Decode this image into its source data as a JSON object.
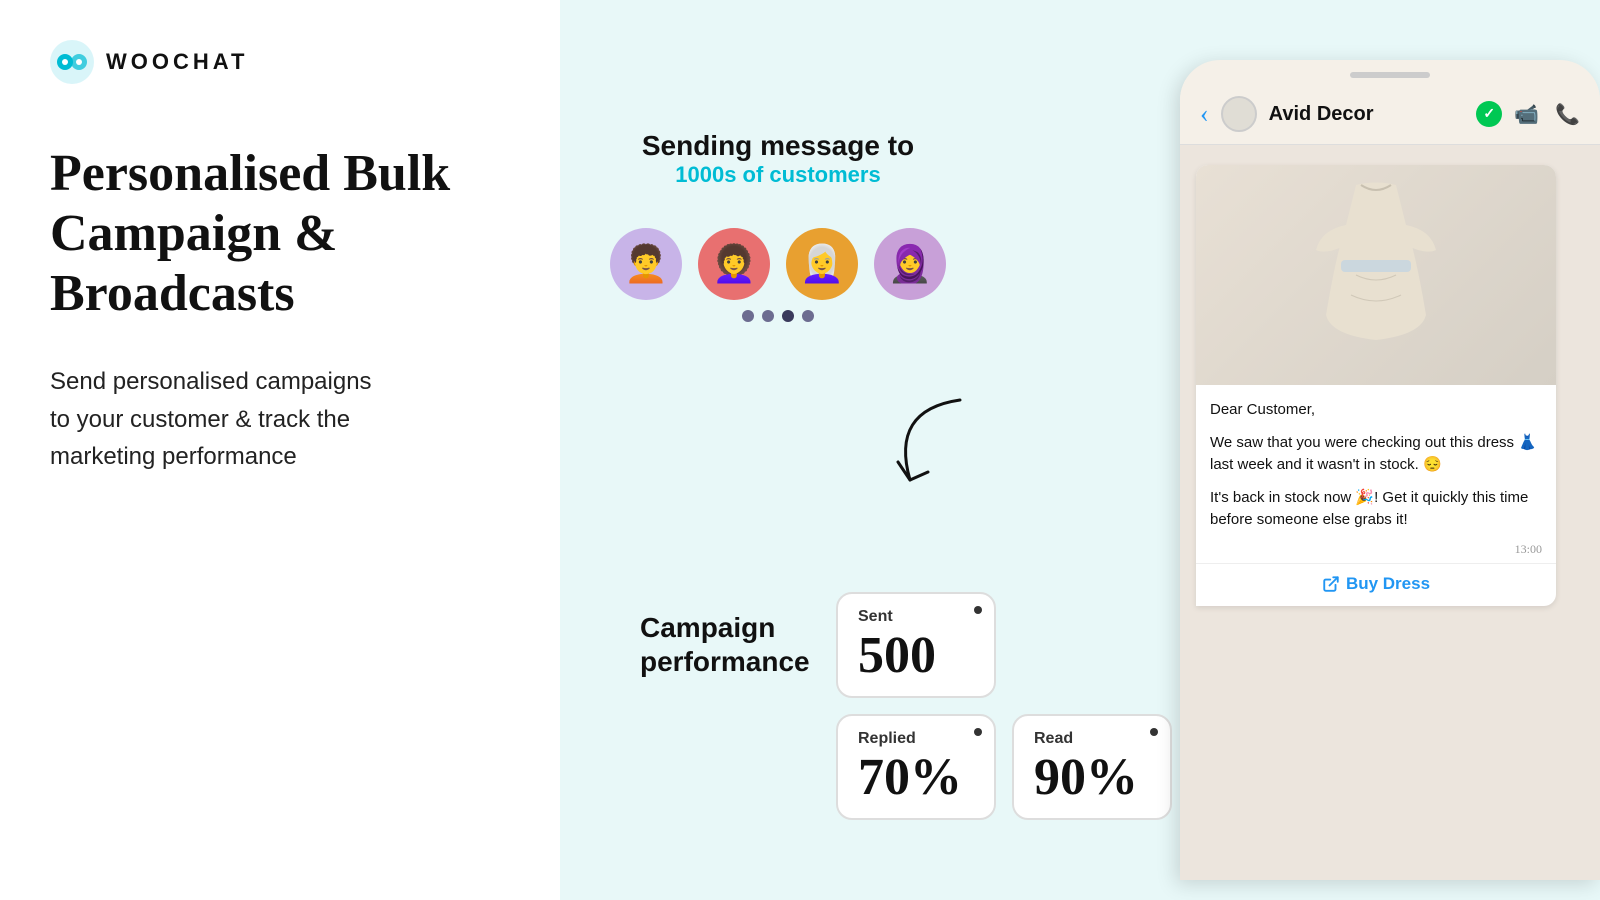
{
  "logo": {
    "text": "WOOCHAT"
  },
  "hero": {
    "heading_line1": "Personalised Bulk",
    "heading_line2": "Campaign & Broadcasts",
    "description_line1": "Send personalised campaigns",
    "description_line2": "to your customer & track the",
    "description_line3": "marketing performance"
  },
  "sending": {
    "title": "Sending message to",
    "subtitle": "1000s of customers"
  },
  "avatars": [
    {
      "emoji": "🧑‍🦱",
      "bg": "#c8b4e8"
    },
    {
      "emoji": "👩‍🦱",
      "bg": "#e87070"
    },
    {
      "emoji": "👩‍🦳",
      "bg": "#e8a030"
    },
    {
      "emoji": "🧕",
      "bg": "#c8a0d8"
    }
  ],
  "campaign": {
    "label_line1": "Campaign",
    "label_line2": "performance"
  },
  "stats": {
    "sent": {
      "label": "Sent",
      "value": "500"
    },
    "replied": {
      "label": "Replied",
      "value": "70%"
    },
    "read": {
      "label": "Read",
      "value": "90%"
    }
  },
  "phone": {
    "contact_name": "Avid Decor",
    "message_greeting": "Dear Customer,",
    "message_body1": "We saw that you were checking out this dress 👗 last week and it wasn't in stock. 😔",
    "message_body2": "It's back in stock now 🎉! Get it quickly this time before someone else grabs it!",
    "timestamp": "13:00",
    "buy_button": "Buy Dress"
  }
}
